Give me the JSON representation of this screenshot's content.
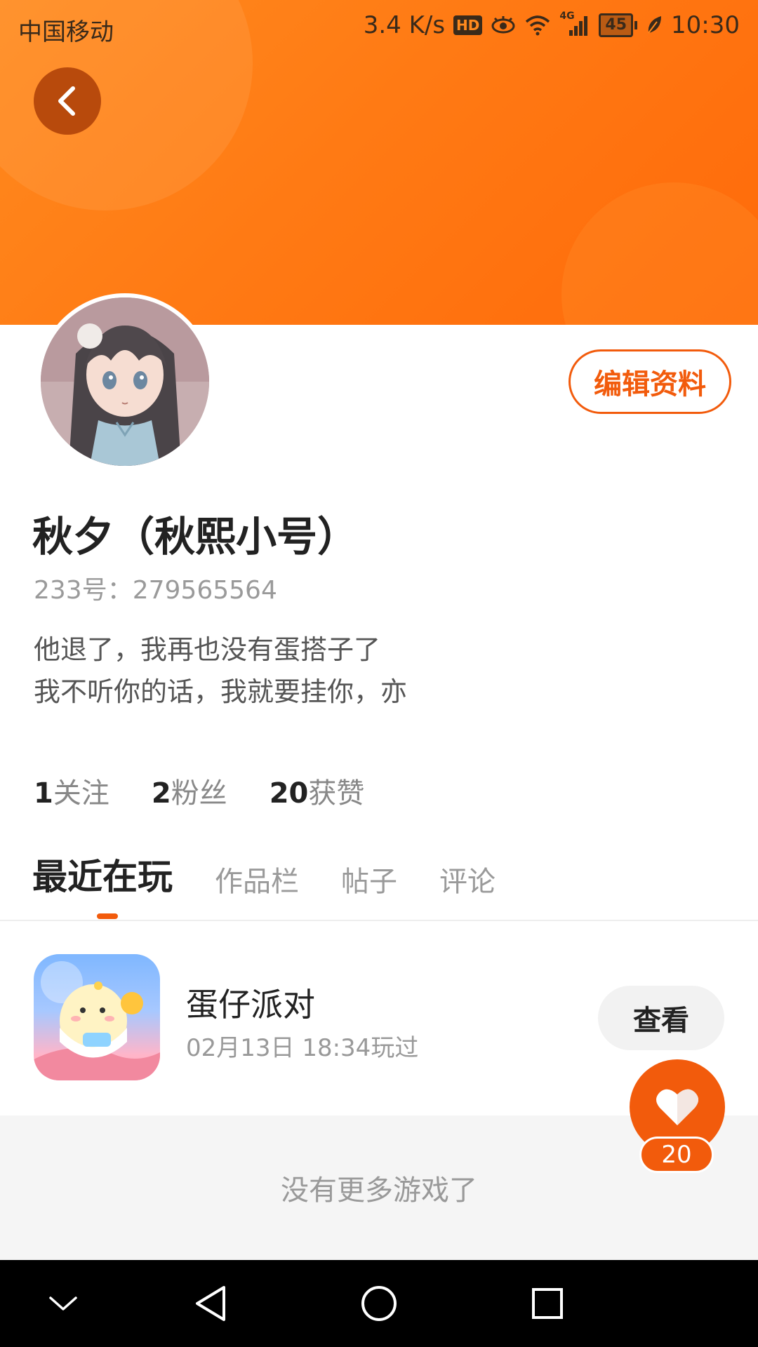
{
  "status_bar": {
    "carrier": "中国移动",
    "net_speed": "3.4 K/s",
    "hd": "HD",
    "network_type": "4G",
    "battery": "45",
    "time": "10:30"
  },
  "profile": {
    "username": "秋夕（秋熙小号）",
    "user_id": "233号：279565564",
    "bio_lines": [
      "他退了，我再也没有蛋搭子了",
      "我不听你的话，我就要挂你，亦"
    ],
    "edit_label": "编辑资料"
  },
  "stats": [
    {
      "num": "1",
      "label": "关注"
    },
    {
      "num": "2",
      "label": "粉丝"
    },
    {
      "num": "20",
      "label": "获赞"
    }
  ],
  "tabs": [
    {
      "label": "最近在玩",
      "active": true
    },
    {
      "label": "作品栏",
      "active": false
    },
    {
      "label": "帖子",
      "active": false
    },
    {
      "label": "评论",
      "active": false
    }
  ],
  "game": {
    "name": "蛋仔派对",
    "played_time": "02月13日 18:34玩过",
    "view_label": "查看"
  },
  "footer": {
    "no_more": "没有更多游戏了"
  },
  "like": {
    "count": "20"
  },
  "colors": {
    "accent": "#f25b0c",
    "header_orange": "#ff7a14"
  }
}
